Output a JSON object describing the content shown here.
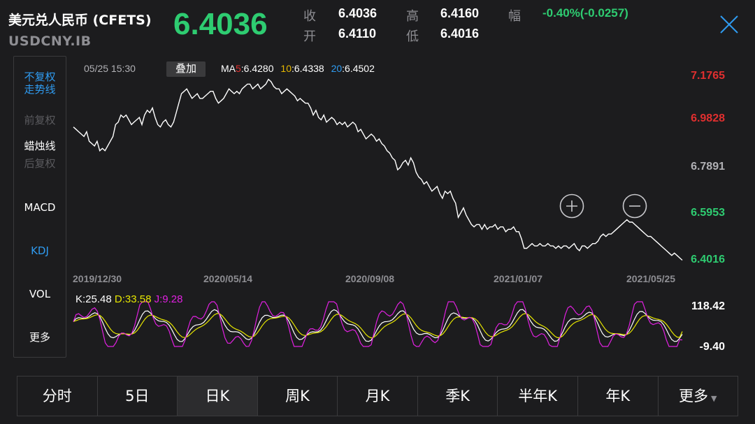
{
  "header": {
    "name": "美元兑人民币 (CFETS)",
    "code": "USDCNY.IB",
    "price": "6.4036",
    "stats": {
      "close_label": "收",
      "close": "6.4036",
      "high_label": "高",
      "high": "6.4160",
      "open_label": "开",
      "open": "6.4110",
      "low_label": "低",
      "low": "6.4016",
      "change_label": "幅",
      "change": "-0.40%(-0.0257)"
    }
  },
  "sidebar": {
    "items": [
      "不复权",
      "走势线",
      "前复权",
      "蜡烛线",
      "后复权",
      "MACD",
      "KDJ",
      "VOL",
      "更多"
    ]
  },
  "info": {
    "time": "05/25 15:30",
    "overlay": "叠加",
    "ma5_label": "MA",
    "ma5_num": "5",
    "ma5": ":6.4280",
    "ma10_num": "10",
    "ma10": ":6.4338",
    "ma20_num": "20",
    "ma20": ":6.4502"
  },
  "kdj": {
    "k": "K:25.48",
    "d": "D:33.58",
    "j": "J:9.28"
  },
  "tabs": [
    "分时",
    "5日",
    "日K",
    "周K",
    "月K",
    "季K",
    "半年K",
    "年K",
    "更多"
  ],
  "colors": {
    "up": "#e02f2f",
    "down": "#2ecc71",
    "accent": "#2f9bf0",
    "k": "#ffffff",
    "d": "#e6e600",
    "j": "#e020e0"
  },
  "chart_data": [
    {
      "type": "line",
      "title": "",
      "x_ticks": [
        "2019/12/30",
        "2020/05/14",
        "2020/09/08",
        "2021/01/07",
        "2021/05/25"
      ],
      "y_ticks": [
        "7.1765",
        "6.9828",
        "6.7891",
        "6.5953",
        "6.4016"
      ],
      "ylim": [
        6.4016,
        7.1765
      ],
      "series": [
        {
          "name": "",
          "values": [
            6.96,
            6.95,
            6.94,
            6.93,
            6.92,
            6.94,
            6.9,
            6.89,
            6.88,
            6.9,
            6.86,
            6.87,
            6.86,
            6.88,
            6.9,
            6.92,
            6.97,
            6.98,
            7.01,
            7.0,
            7.01,
            6.99,
            6.97,
            6.98,
            6.99,
            7.0,
            6.97,
            7.01,
            7.03,
            7.02,
            7.04,
            7.0,
            6.97,
            6.96,
            6.98,
            6.99,
            6.97,
            6.96,
            6.98,
            7.02,
            7.06,
            7.1,
            7.11,
            7.12,
            7.1,
            7.08,
            7.09,
            7.1,
            7.08,
            7.08,
            7.09,
            7.1,
            7.11,
            7.11,
            7.08,
            7.06,
            7.07,
            7.08,
            7.1,
            7.12,
            7.11,
            7.1,
            7.11,
            7.1,
            7.12,
            7.13,
            7.14,
            7.14,
            7.12,
            7.13,
            7.14,
            7.12,
            7.13,
            7.14,
            7.16,
            7.15,
            7.13,
            7.12,
            7.12,
            7.1,
            7.11,
            7.12,
            7.11,
            7.1,
            7.09,
            7.07,
            7.08,
            7.07,
            7.06,
            7.06,
            7.04,
            7.01,
            7.03,
            7.0,
            6.99,
            7.01,
            6.98,
            6.99,
            7.0,
            6.99,
            6.97,
            6.98,
            6.97,
            6.98,
            6.96,
            6.97,
            6.98,
            6.97,
            6.94,
            6.95,
            6.93,
            6.91,
            6.92,
            6.93,
            6.92,
            6.9,
            6.91,
            6.89,
            6.88,
            6.86,
            6.85,
            6.83,
            6.82,
            6.78,
            6.79,
            6.81,
            6.82,
            6.8,
            6.83,
            6.81,
            6.77,
            6.75,
            6.74,
            6.72,
            6.73,
            6.71,
            6.69,
            6.7,
            6.71,
            6.68,
            6.66,
            6.69,
            6.68,
            6.69,
            6.66,
            6.64,
            6.58,
            6.6,
            6.62,
            6.59,
            6.57,
            6.55,
            6.54,
            6.55,
            6.55,
            6.53,
            6.55,
            6.53,
            6.54,
            6.54,
            6.55,
            6.53,
            6.54,
            6.54,
            6.52,
            6.53,
            6.53,
            6.54,
            6.52,
            6.52,
            6.49,
            6.45,
            6.45,
            6.46,
            6.47,
            6.46,
            6.46,
            6.47,
            6.46,
            6.46,
            6.47,
            6.46,
            6.46,
            6.45,
            6.46,
            6.45,
            6.46,
            6.46,
            6.45,
            6.46,
            6.47,
            6.45,
            6.44,
            6.46,
            6.46,
            6.45,
            6.46,
            6.47,
            6.47,
            6.48,
            6.5,
            6.51,
            6.5,
            6.51,
            6.51,
            6.52,
            6.53,
            6.54,
            6.55,
            6.56,
            6.57,
            6.56,
            6.56,
            6.55,
            6.54,
            6.53,
            6.52,
            6.51,
            6.5,
            6.5,
            6.49,
            6.48,
            6.47,
            6.46,
            6.45,
            6.44,
            6.43,
            6.42,
            6.43,
            6.42,
            6.41,
            6.4
          ]
        }
      ]
    },
    {
      "type": "line",
      "title": "",
      "y_ticks": [
        "118.42",
        "-9.40"
      ],
      "ylim": [
        -9.4,
        118.42
      ],
      "series": [
        {
          "name": "K",
          "values": []
        },
        {
          "name": "D",
          "values": []
        },
        {
          "name": "J",
          "values": []
        }
      ]
    }
  ]
}
